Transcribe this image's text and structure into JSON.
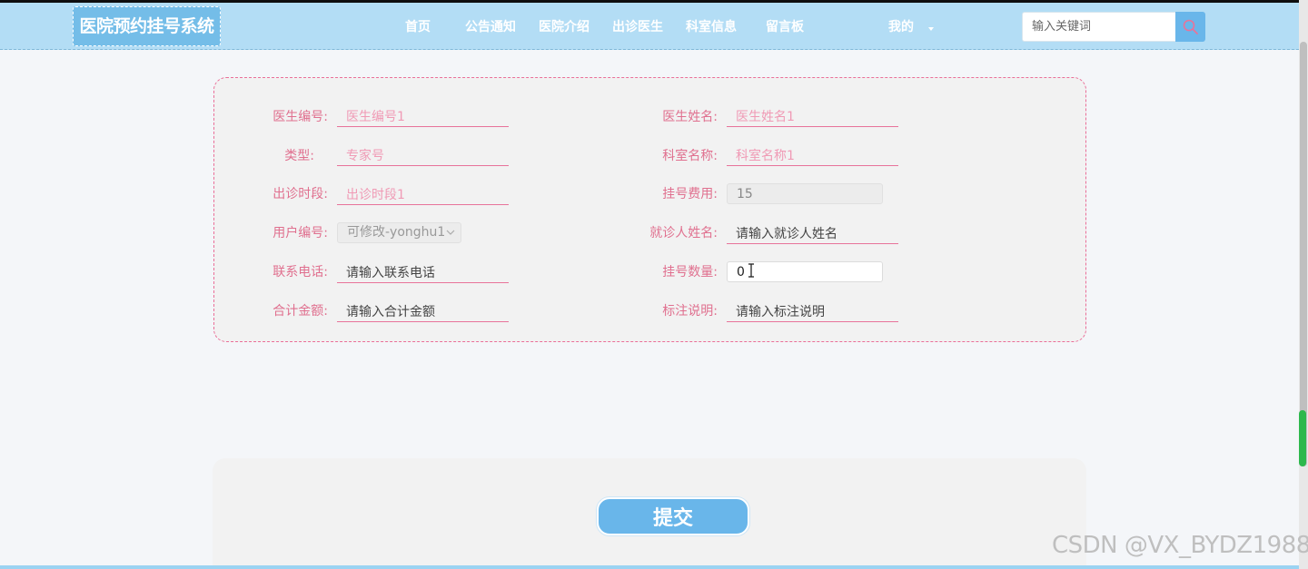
{
  "header": {
    "logo_text": "医院预约挂号系统",
    "nav": [
      "首页",
      "公告通知",
      "医院介绍",
      "出诊医生",
      "科室信息",
      "留言板",
      "我的"
    ],
    "search_placeholder": "输入关键词"
  },
  "form": {
    "doctor_no": {
      "label": "医生编号:",
      "placeholder": "医生编号1"
    },
    "doctor_name": {
      "label": "医生姓名:",
      "placeholder": "医生姓名1"
    },
    "type": {
      "label": "类型:",
      "placeholder": "专家号"
    },
    "dept_name": {
      "label": "科室名称:",
      "placeholder": "科室名称1"
    },
    "time_slot": {
      "label": "出诊时段:",
      "placeholder": "出诊时段1"
    },
    "fee": {
      "label": "挂号费用:",
      "value": "15"
    },
    "user_no": {
      "label": "用户编号:",
      "selected": "可修改-yonghu1"
    },
    "patient_name": {
      "label": "就诊人姓名:",
      "placeholder": "请输入就诊人姓名"
    },
    "phone": {
      "label": "联系电话:",
      "placeholder": "请输入联系电话"
    },
    "quantity": {
      "label": "挂号数量:",
      "value": "0"
    },
    "total": {
      "label": "合计金额:",
      "placeholder": "请输入合计金额"
    },
    "remark": {
      "label": "标注说明:",
      "placeholder": "请输入标注说明"
    }
  },
  "submit_label": "提交",
  "watermark": "CSDN @VX_BYDZ1988",
  "colors": {
    "header_bg": "#b3ddf5",
    "accent_blue": "#69b6ea",
    "label_pink": "#e0708f",
    "border_pink": "#ea6e98"
  },
  "icons": {
    "search": "search-icon",
    "dropdown": "chevron-down-icon",
    "caret": "caret-down-icon"
  }
}
